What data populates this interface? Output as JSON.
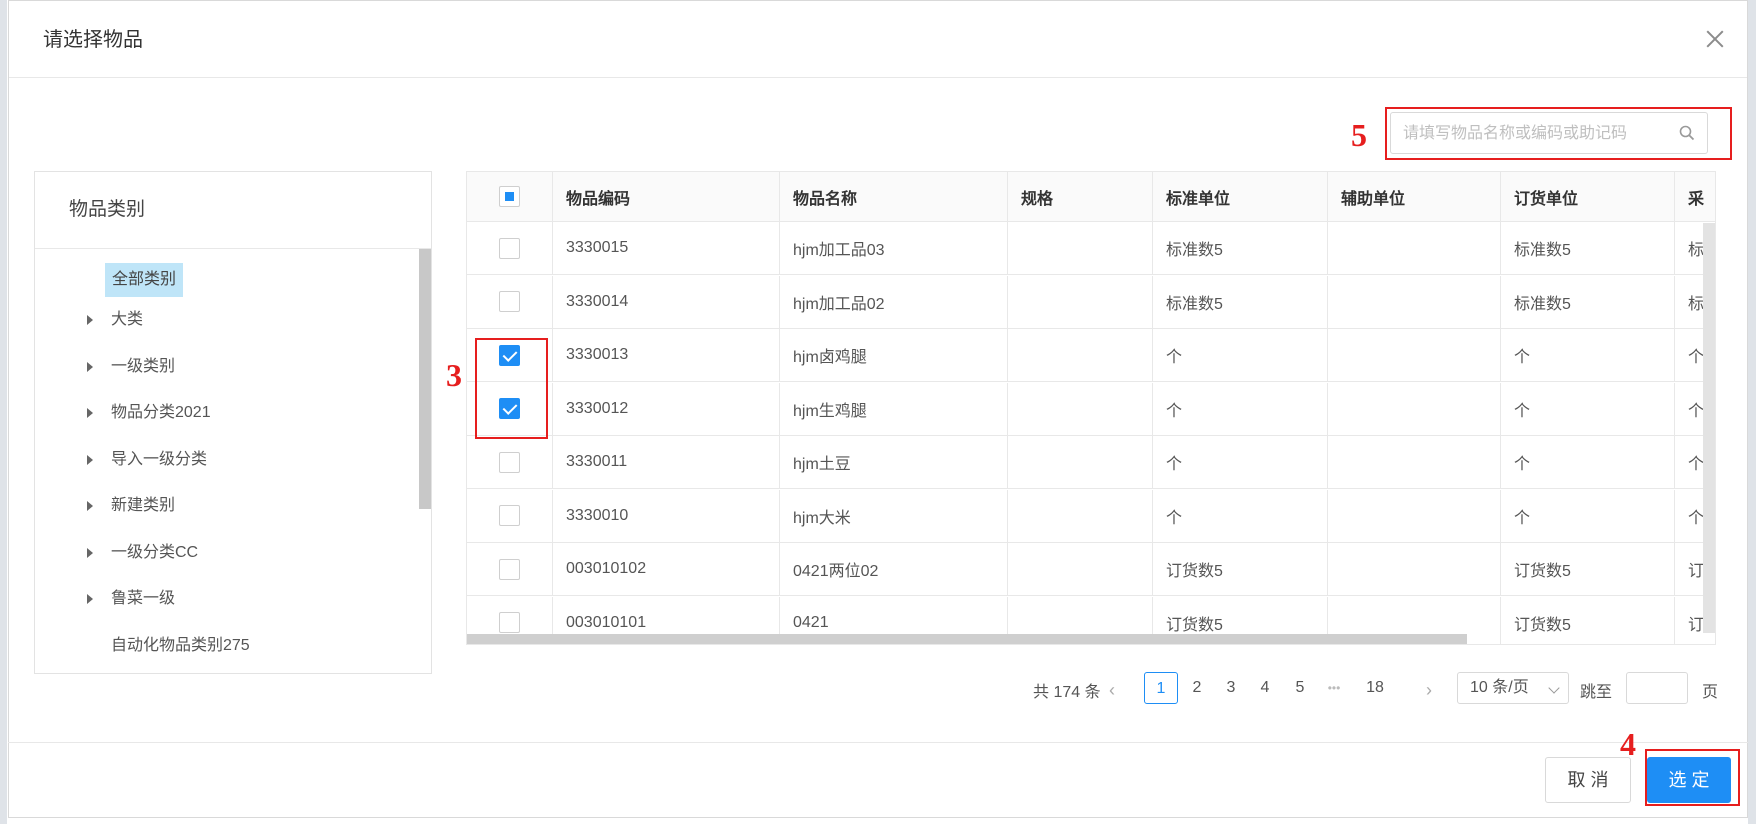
{
  "dialog": {
    "title": "请选择物品"
  },
  "search": {
    "placeholder": "请填写物品名称或编码或助记码"
  },
  "category_panel": {
    "title": "物品类别",
    "root": "全部类别",
    "items": [
      {
        "label": "大类",
        "has_children": true
      },
      {
        "label": "一级类别",
        "has_children": true
      },
      {
        "label": "物品分类2021",
        "has_children": true
      },
      {
        "label": "导入一级分类",
        "has_children": true
      },
      {
        "label": "新建类别",
        "has_children": true
      },
      {
        "label": "一级分类CC",
        "has_children": true
      },
      {
        "label": "鲁菜一级",
        "has_children": true
      },
      {
        "label": "自动化物品类别275",
        "has_children": false
      }
    ]
  },
  "table": {
    "columns": [
      "物品编码",
      "物品名称",
      "规格",
      "标准单位",
      "辅助单位",
      "订货单位",
      "采"
    ],
    "rows": [
      {
        "code": "3330015",
        "name": "hjm加工品03",
        "spec": "",
        "std_unit": "标准数5",
        "aux_unit": "",
        "order_unit": "标准数5",
        "more": "标",
        "checked": false
      },
      {
        "code": "3330014",
        "name": "hjm加工品02",
        "spec": "",
        "std_unit": "标准数5",
        "aux_unit": "",
        "order_unit": "标准数5",
        "more": "标",
        "checked": false
      },
      {
        "code": "3330013",
        "name": "hjm卤鸡腿",
        "spec": "",
        "std_unit": "个",
        "aux_unit": "",
        "order_unit": "个",
        "more": "个",
        "checked": true
      },
      {
        "code": "3330012",
        "name": "hjm生鸡腿",
        "spec": "",
        "std_unit": "个",
        "aux_unit": "",
        "order_unit": "个",
        "more": "个",
        "checked": true
      },
      {
        "code": "3330011",
        "name": "hjm土豆",
        "spec": "",
        "std_unit": "个",
        "aux_unit": "",
        "order_unit": "个",
        "more": "个",
        "checked": false
      },
      {
        "code": "3330010",
        "name": "hjm大米",
        "spec": "",
        "std_unit": "个",
        "aux_unit": "",
        "order_unit": "个",
        "more": "个",
        "checked": false
      },
      {
        "code": "003010102",
        "name": "0421两位02",
        "spec": "",
        "std_unit": "订货数5",
        "aux_unit": "",
        "order_unit": "订货数5",
        "more": "订",
        "checked": false
      },
      {
        "code": "003010101",
        "name": "0421",
        "spec": "",
        "std_unit": "订货数5",
        "aux_unit": "",
        "order_unit": "订货数5",
        "more": "订",
        "checked": false
      }
    ]
  },
  "pagination": {
    "total": "共 174 条",
    "prev": "‹",
    "next": "›",
    "pages": [
      "1",
      "2",
      "3",
      "4",
      "5",
      "•••",
      "18"
    ],
    "current": "1",
    "page_size": "10 条/页",
    "jump_label": "跳至",
    "page_label": "页"
  },
  "footer": {
    "cancel": "取 消",
    "ok": "选 定"
  },
  "annotations": {
    "n3": "3",
    "n4": "4",
    "n5": "5",
    "color": "#e61e1e"
  },
  "colors": {
    "primary": "#1e8ef5",
    "selected_category_bg": "#bfe5f8"
  }
}
